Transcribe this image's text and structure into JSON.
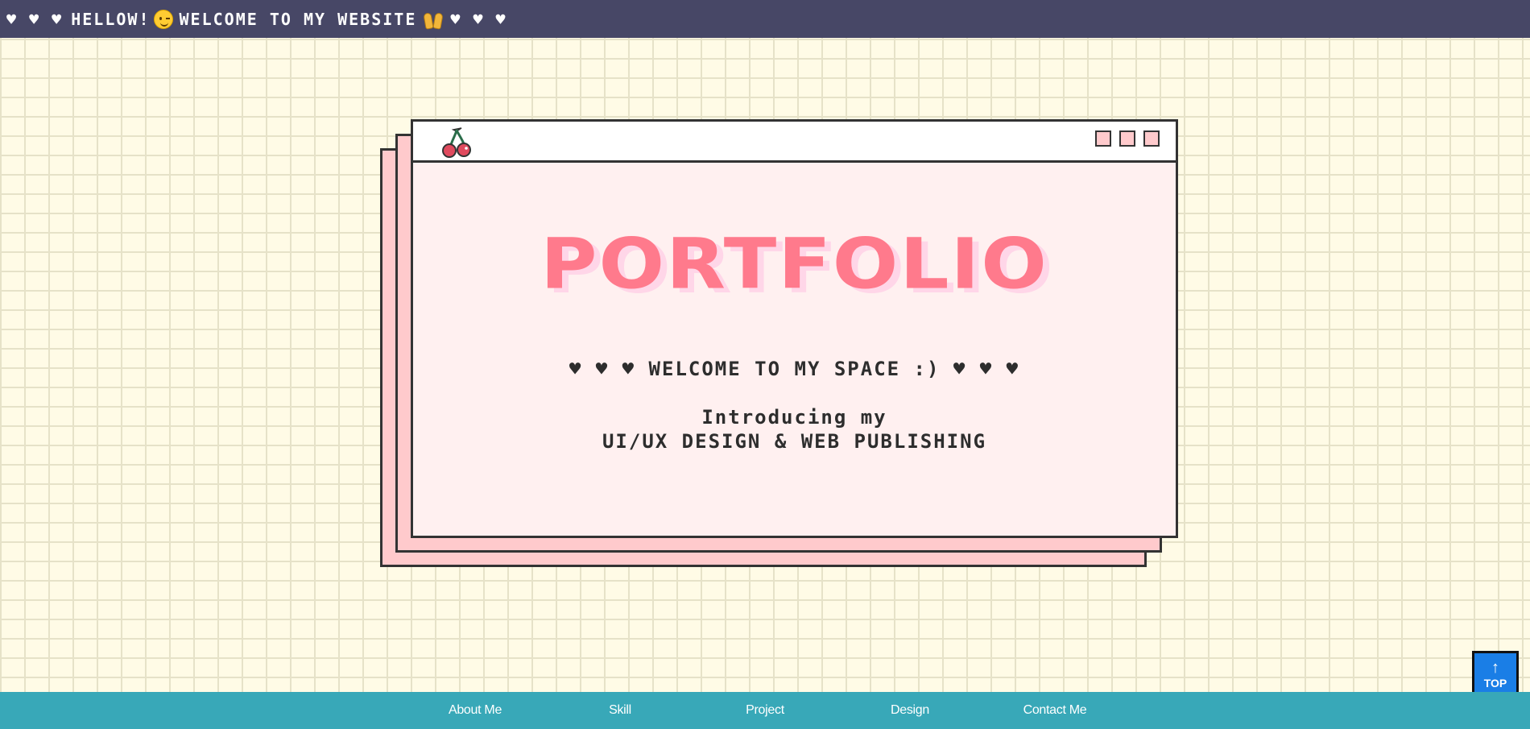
{
  "top_bar": {
    "hearts_left": "♥ ♥ ♥",
    "greeting": "HELLOW!",
    "welcome": "WELCOME TO MY WEBSITE",
    "hearts_right": "♥ ♥ ♥",
    "emoji_wink": "winking-face-icon",
    "emoji_hands": "raising-hands-icon"
  },
  "window": {
    "logo": "cherry-icon",
    "controls": [
      "square-button",
      "square-button",
      "square-button"
    ],
    "title": "PORTFOLIO",
    "welcome": "♥ ♥ ♥ WELCOME TO MY SPACE :) ♥ ♥ ♥",
    "intro_line1": "Introducing my",
    "intro_line2": "UI/UX DESIGN & WEB PUBLISHING"
  },
  "nav": {
    "items": [
      "About Me",
      "Skill",
      "Project",
      "Design",
      "Contact Me"
    ]
  },
  "top_button": {
    "arrow": "↑",
    "label": "TOP"
  },
  "colors": {
    "top_bar": "#474766",
    "background": "#fffbe6",
    "window_pink": "#ffcacc",
    "title_pink": "#ff7a8c",
    "nav_teal": "#38a8b8",
    "top_button_blue": "#1a7ee6"
  }
}
